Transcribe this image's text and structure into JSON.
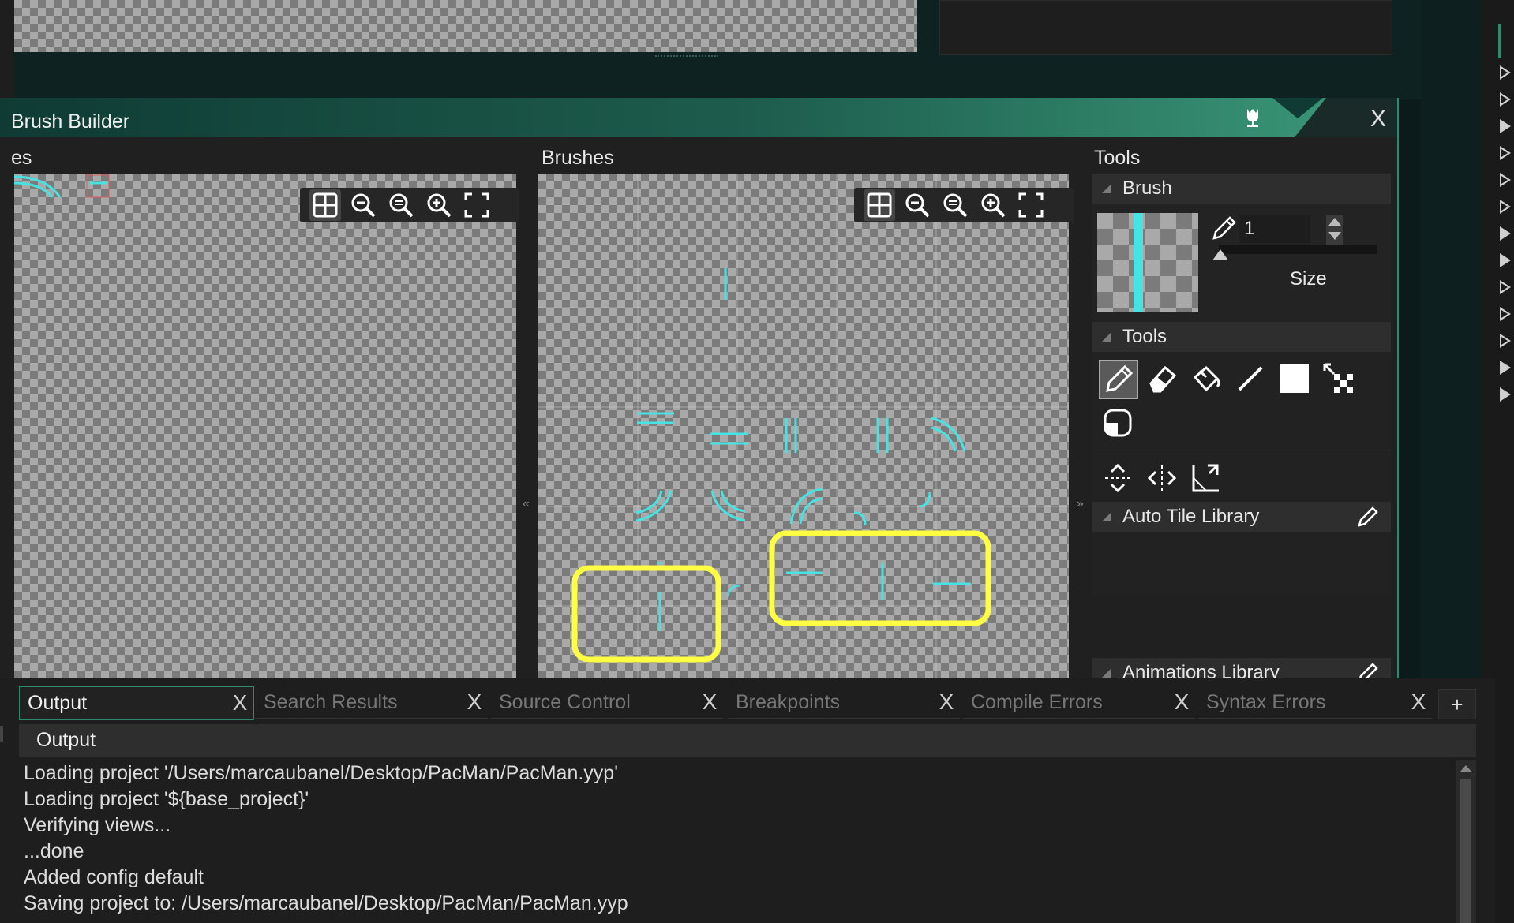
{
  "window": {
    "title": "Brush Builder",
    "close_glyph": "X"
  },
  "left_panel": {
    "header": "es"
  },
  "brushes_panel": {
    "header": "Brushes"
  },
  "collapse": {
    "left": "«",
    "right": "»"
  },
  "tools_panel": {
    "header": "Tools",
    "brush_section": {
      "title": "Brush",
      "size_value": "1",
      "size_label": "Size"
    },
    "tools_section": {
      "title": "Tools"
    },
    "auto_tile_label": "Auto Tile Library",
    "animations_label": "Animations Library"
  },
  "output_tabs": [
    {
      "label": "Output",
      "active": true
    },
    {
      "label": "Search Results",
      "active": false
    },
    {
      "label": "Source Control",
      "active": false
    },
    {
      "label": "Breakpoints",
      "active": false
    },
    {
      "label": "Compile Errors",
      "active": false
    },
    {
      "label": "Syntax Errors",
      "active": false
    }
  ],
  "tab_close_glyph": "X",
  "add_tab_glyph": "+",
  "output": {
    "title": "Output",
    "lines": [
      "Loading project '/Users/marcaubanel/Desktop/PacMan/PacMan.yyp'",
      "Loading project '${base_project}'",
      "Verifying views...",
      "...done",
      "Added config default",
      "Saving project to: /Users/marcaubanel/Desktop/PacMan/PacMan.yyp"
    ]
  },
  "colors": {
    "accent_teal": "#2c8a6e",
    "tile_cyan": "#47e3e3",
    "highlight_yellow": "#ffff44",
    "panel_bg": "#222222"
  },
  "icons": {
    "zoom_toolbar": [
      "grid-toggle-icon",
      "zoom-out-icon",
      "zoom-reset-icon",
      "zoom-in-icon",
      "fullscreen-icon"
    ],
    "tools": [
      "pencil-icon",
      "eraser-icon",
      "fill-bucket-icon",
      "line-icon",
      "rectangle-icon",
      "select-icon",
      "ellipse-icon"
    ],
    "transform": [
      "flip-vertical-icon",
      "flip-horizontal-icon",
      "rotate-icon"
    ]
  }
}
